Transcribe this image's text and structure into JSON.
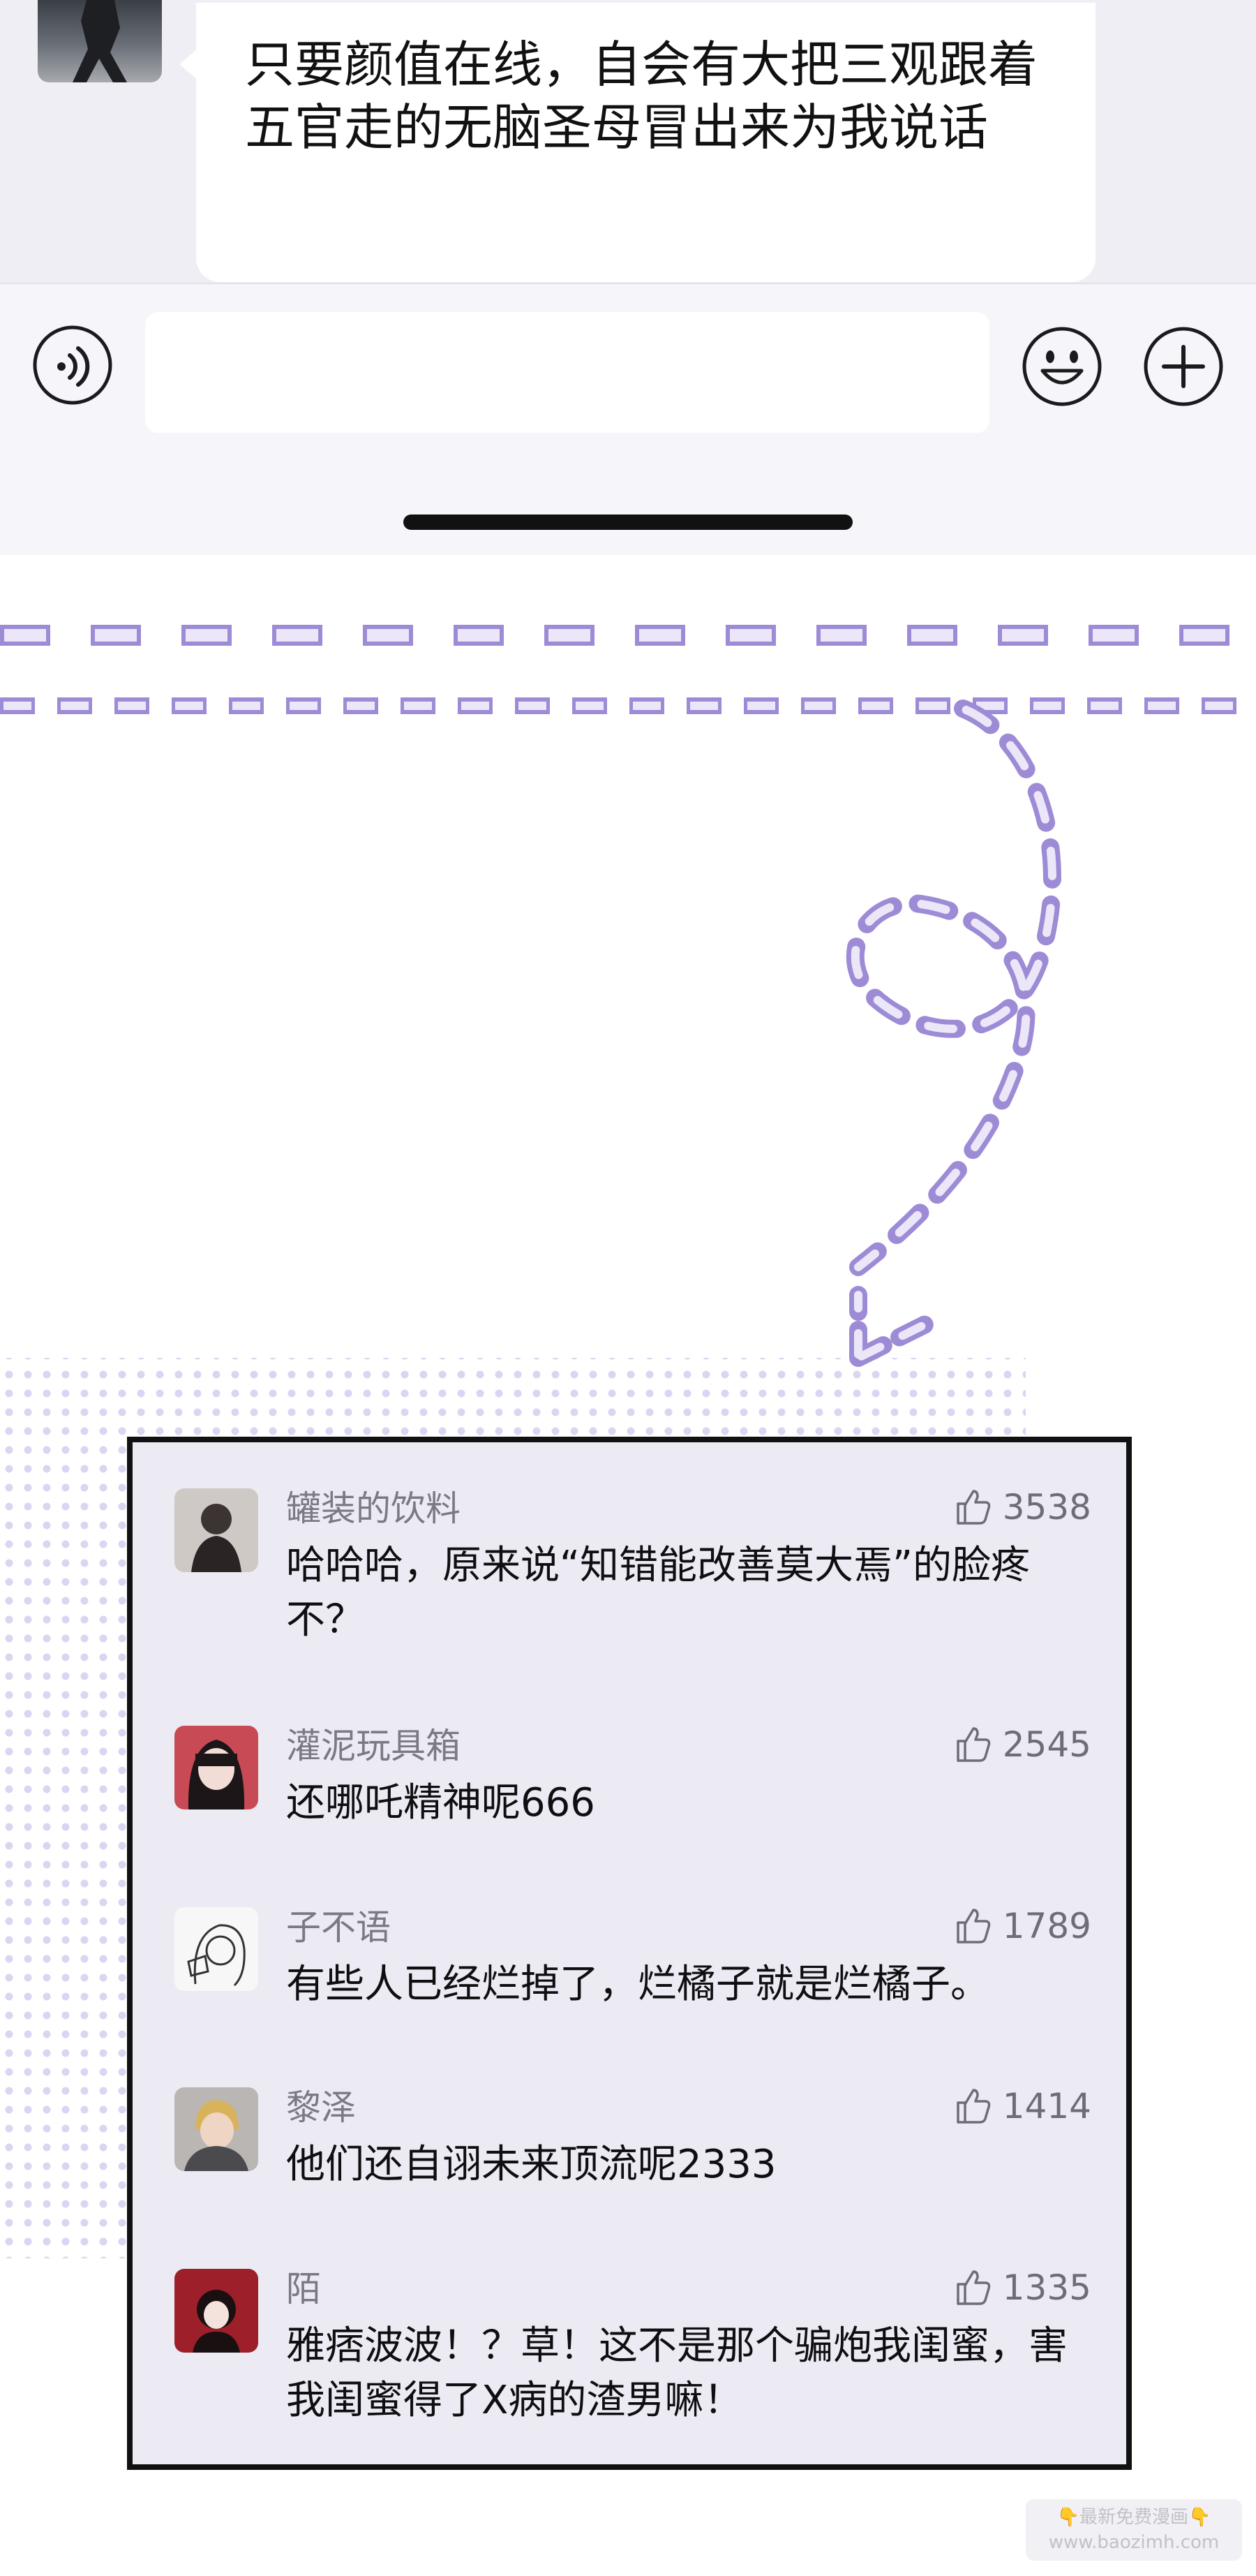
{
  "chat": {
    "message_text": "只要颜值在线，自会有大把三观跟着五官走的无脑圣母冒出来为我说话",
    "input_value": ""
  },
  "icons": {
    "voice": "voice-icon",
    "emoji": "emoji-icon",
    "plus": "plus-icon",
    "like": "thumbs-up-icon"
  },
  "colors": {
    "accent_purple": "#9e8bd6",
    "panel_background": "#ecebf3",
    "panel_border": "#111111",
    "name_gray": "#7b7a83"
  },
  "comments": [
    {
      "name": "罐装的饮料",
      "likes": "3538",
      "text": "哈哈哈，原来说“知错能改善莫大焉”的脸疼不？"
    },
    {
      "name": "灌泥玩具箱",
      "likes": "2545",
      "text": "还哪吒精神呢666"
    },
    {
      "name": "子不语",
      "likes": "1789",
      "text": "有些人已经烂掉了，烂橘子就是烂橘子。"
    },
    {
      "name": "黎泽",
      "likes": "1414",
      "text": "他们还自诩未来顶流呢2333"
    },
    {
      "name": "陌",
      "likes": "1335",
      "text": "雅痞波波！？草！这不是那个骗炮我闺蜜，害我闺蜜得了X病的渣男嘛！"
    }
  ],
  "watermark": {
    "line1": "👇最新免费漫画👇",
    "line2": "www.baozimh.com"
  }
}
